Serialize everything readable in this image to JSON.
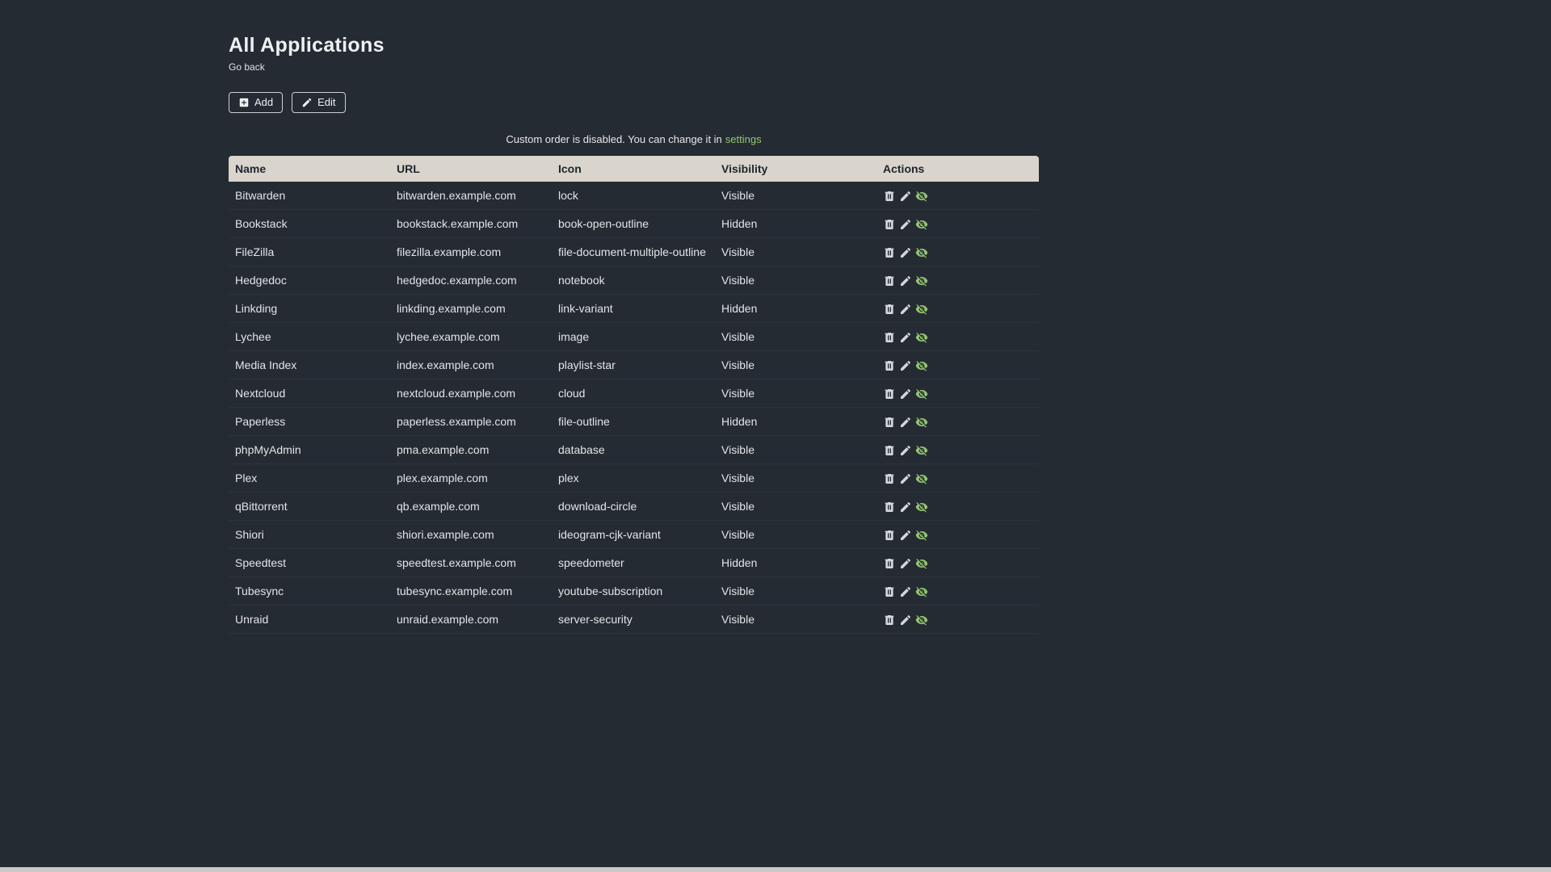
{
  "page": {
    "title": "All Applications",
    "back_link": "Go back",
    "notice_text": "Custom order is disabled. You can change it in",
    "notice_link": "settings"
  },
  "toolbar": {
    "add_label": "Add",
    "edit_label": "Edit"
  },
  "colors": {
    "accent_green": "#95c672",
    "background": "#252b33",
    "table_header_bg": "#d9d5cd"
  },
  "table": {
    "headers": [
      "Name",
      "URL",
      "Icon",
      "Visibility",
      "Actions"
    ],
    "action_icon_names": [
      "delete-icon",
      "edit-icon",
      "visibility-toggle-icon"
    ],
    "rows": [
      {
        "name": "Bitwarden",
        "url": "bitwarden.example.com",
        "icon": "lock",
        "visibility": "Visible"
      },
      {
        "name": "Bookstack",
        "url": "bookstack.example.com",
        "icon": "book-open-outline",
        "visibility": "Hidden"
      },
      {
        "name": "FileZilla",
        "url": "filezilla.example.com",
        "icon": "file-document-multiple-outline",
        "visibility": "Visible"
      },
      {
        "name": "Hedgedoc",
        "url": "hedgedoc.example.com",
        "icon": "notebook",
        "visibility": "Visible"
      },
      {
        "name": "Linkding",
        "url": "linkding.example.com",
        "icon": "link-variant",
        "visibility": "Hidden"
      },
      {
        "name": "Lychee",
        "url": "lychee.example.com",
        "icon": "image",
        "visibility": "Visible"
      },
      {
        "name": "Media Index",
        "url": "index.example.com",
        "icon": "playlist-star",
        "visibility": "Visible"
      },
      {
        "name": "Nextcloud",
        "url": "nextcloud.example.com",
        "icon": "cloud",
        "visibility": "Visible"
      },
      {
        "name": "Paperless",
        "url": "paperless.example.com",
        "icon": "file-outline",
        "visibility": "Hidden"
      },
      {
        "name": "phpMyAdmin",
        "url": "pma.example.com",
        "icon": "database",
        "visibility": "Visible"
      },
      {
        "name": "Plex",
        "url": "plex.example.com",
        "icon": "plex",
        "visibility": "Visible"
      },
      {
        "name": "qBittorrent",
        "url": "qb.example.com",
        "icon": "download-circle",
        "visibility": "Visible"
      },
      {
        "name": "Shiori",
        "url": "shiori.example.com",
        "icon": "ideogram-cjk-variant",
        "visibility": "Visible"
      },
      {
        "name": "Speedtest",
        "url": "speedtest.example.com",
        "icon": "speedometer",
        "visibility": "Hidden"
      },
      {
        "name": "Tubesync",
        "url": "tubesync.example.com",
        "icon": "youtube-subscription",
        "visibility": "Visible"
      },
      {
        "name": "Unraid",
        "url": "unraid.example.com",
        "icon": "server-security",
        "visibility": "Visible"
      }
    ]
  }
}
